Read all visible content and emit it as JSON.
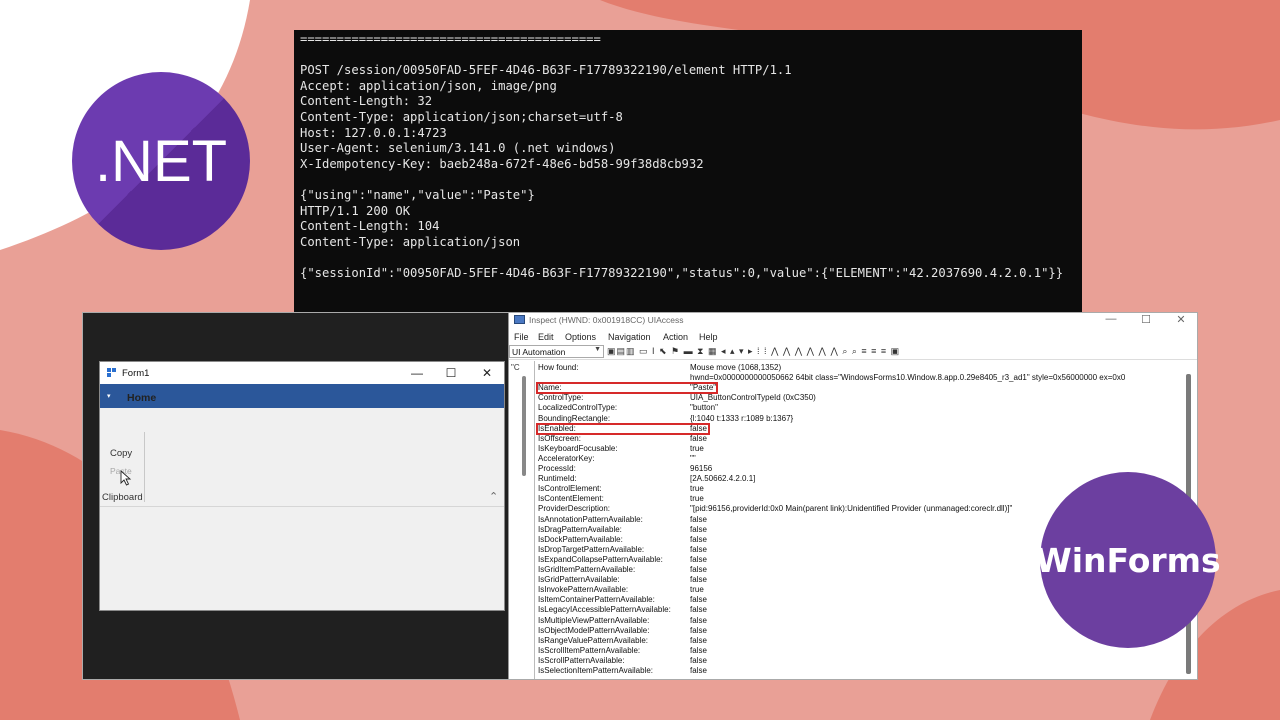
{
  "logos": {
    "dotnet": ".NET",
    "winforms": "WinForms"
  },
  "terminal": {
    "lines": [
      "=========================================",
      "",
      "POST /session/00950FAD-5FEF-4D46-B63F-F17789322190/element HTTP/1.1",
      "Accept: application/json, image/png",
      "Content-Length: 32",
      "Content-Type: application/json;charset=utf-8",
      "Host: 127.0.0.1:4723",
      "User-Agent: selenium/3.141.0 (.net windows)",
      "X-Idempotency-Key: baeb248a-672f-48e6-bd58-99f38d8cb932",
      "",
      "{\"using\":\"name\",\"value\":\"Paste\"}",
      "HTTP/1.1 200 OK",
      "Content-Length: 104",
      "Content-Type: application/json",
      "",
      "{\"sessionId\":\"00950FAD-5FEF-4D46-B63F-F17789322190\",\"status\":0,\"value\":{\"ELEMENT\":\"42.2037690.4.2.0.1\"}}"
    ]
  },
  "form1": {
    "title": "Form1",
    "minimize": "—",
    "maximize": "☐",
    "close": "✕",
    "quick_access": "▾",
    "tab_home": "Home",
    "copy_label": "Copy",
    "paste_label": "Paste",
    "group_label": "Clipboard",
    "collapse": "⌃"
  },
  "inspect": {
    "title": "Inspect  (HWND: 0x001918CC) UIAccess",
    "minimize": "—",
    "maximize": "☐",
    "close": "✕",
    "menu": [
      "File",
      "Edit",
      "Options",
      "Navigation",
      "Action",
      "Help"
    ],
    "mode": "UI Automation",
    "tree_text": "\"C",
    "properties": [
      {
        "name": "How found:",
        "value": "Mouse move (1068,1352)"
      },
      {
        "name": "",
        "value": "hwnd=0x0000000000050662 64bit class=\"WindowsForms10.Window.8.app.0.29e8405_r3_ad1\" style=0x56000000 ex=0x0"
      },
      {
        "name": "Name:",
        "value": "\"Paste\""
      },
      {
        "name": "ControlType:",
        "value": "UIA_ButtonControlTypeId (0xC350)"
      },
      {
        "name": "LocalizedControlType:",
        "value": "\"button\""
      },
      {
        "name": "BoundingRectangle:",
        "value": "{l:1040 t:1333 r:1089 b:1367}"
      },
      {
        "name": "IsEnabled:",
        "value": "false"
      },
      {
        "name": "IsOffscreen:",
        "value": "false"
      },
      {
        "name": "IsKeyboardFocusable:",
        "value": "true"
      },
      {
        "name": "AcceleratorKey:",
        "value": "\"\""
      },
      {
        "name": "ProcessId:",
        "value": "96156"
      },
      {
        "name": "RuntimeId:",
        "value": "[2A.50662.4.2.0.1]"
      },
      {
        "name": "IsControlElement:",
        "value": "true"
      },
      {
        "name": "IsContentElement:",
        "value": "true"
      },
      {
        "name": "ProviderDescription:",
        "value": "\"[pid:96156,providerId:0x0 Main(parent link):Unidentified Provider (unmanaged:coreclr.dll)]\""
      },
      {
        "name": "IsAnnotationPatternAvailable:",
        "value": "false"
      },
      {
        "name": "IsDragPatternAvailable:",
        "value": "false"
      },
      {
        "name": "IsDockPatternAvailable:",
        "value": "false"
      },
      {
        "name": "IsDropTargetPatternAvailable:",
        "value": "false"
      },
      {
        "name": "IsExpandCollapsePatternAvailable:",
        "value": "false"
      },
      {
        "name": "IsGridItemPatternAvailable:",
        "value": "false"
      },
      {
        "name": "IsGridPatternAvailable:",
        "value": "false"
      },
      {
        "name": "IsInvokePatternAvailable:",
        "value": "true"
      },
      {
        "name": "IsItemContainerPatternAvailable:",
        "value": "false"
      },
      {
        "name": "IsLegacyIAccessiblePatternAvailable:",
        "value": "false"
      },
      {
        "name": "IsMultipleViewPatternAvailable:",
        "value": "false"
      },
      {
        "name": "IsObjectModelPatternAvailable:",
        "value": "false"
      },
      {
        "name": "IsRangeValuePatternAvailable:",
        "value": "false"
      },
      {
        "name": "IsScrollItemPatternAvailable:",
        "value": "false"
      },
      {
        "name": "IsScrollPatternAvailable:",
        "value": "false"
      },
      {
        "name": "IsSelectionItemPatternAvailable:",
        "value": "false"
      }
    ]
  },
  "colors": {
    "background": "#e9a096",
    "dotnet_purple": "#6c3bb0",
    "winforms_purple": "#6c3fa0",
    "ribbon_blue": "#2b579a",
    "highlight_red": "#d62a2a"
  }
}
